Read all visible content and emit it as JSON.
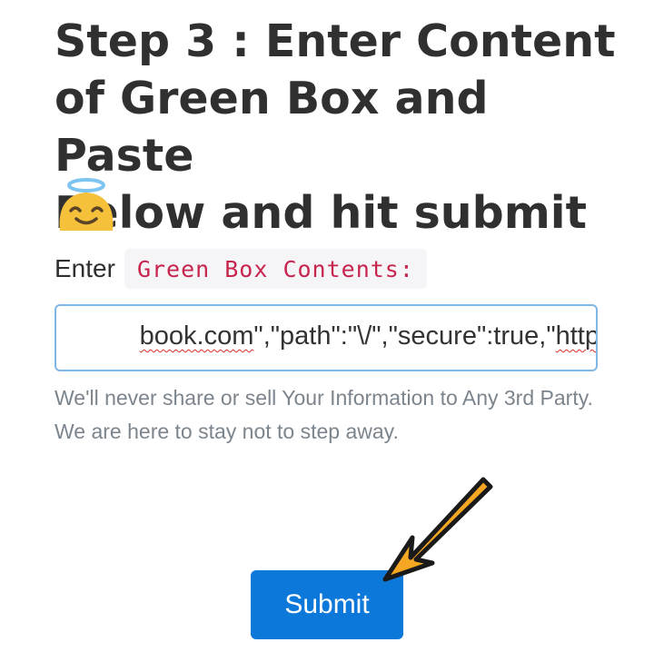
{
  "heading": {
    "line1": "Step 3 : Enter Content",
    "line2": "of Green Box and Paste",
    "line3": "Below and hit submit"
  },
  "emoji": {
    "icon": "smiling-face-with-halo-icon",
    "color": "#f6c13a"
  },
  "form": {
    "label": "Enter",
    "code_label": "Green Box Contents:",
    "input": {
      "value_part1": "book.com",
      "value_part2": "\",\"path\":\"\\/\",\"secure\":true,\"",
      "value_part3": "http"
    },
    "help_line1": "We'll never share or sell Your Information to Any 3rd Party.",
    "help_line2": "We are here to stay not to step away.",
    "submit_label": "Submit"
  },
  "colors": {
    "heading": "#303030",
    "code": "#c7254e",
    "input_border": "#7fb7e6",
    "help": "#7c858d",
    "button": "#0c78d9",
    "arrow": "#f5a623"
  }
}
